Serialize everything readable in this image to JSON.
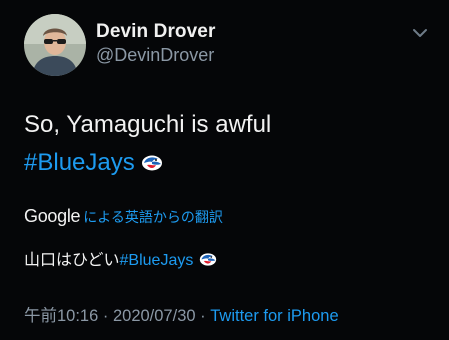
{
  "author": {
    "display_name": "Devin Drover",
    "handle": "@DevinDrover"
  },
  "tweet": {
    "line1": "So, Yamaguchi is awful",
    "hashtag": "#BlueJays"
  },
  "translation": {
    "provider": "Google",
    "link_text": "による英語からの翻訳",
    "text": "山口はひどい",
    "hashtag": "#BlueJays"
  },
  "meta": {
    "time": "午前10:16",
    "sep1": " · ",
    "date": "2020/07/30",
    "sep2": " · ",
    "source": "Twitter for iPhone"
  },
  "icons": {
    "avatar": "profile-photo",
    "menu": "chevron-down-icon",
    "hashtag_emoji": "blue-jays-logo-icon"
  },
  "colors": {
    "background": "#050608",
    "link": "#1d9bf0",
    "secondary_text": "#8b98a5",
    "primary_text": "#f2f2f2"
  }
}
